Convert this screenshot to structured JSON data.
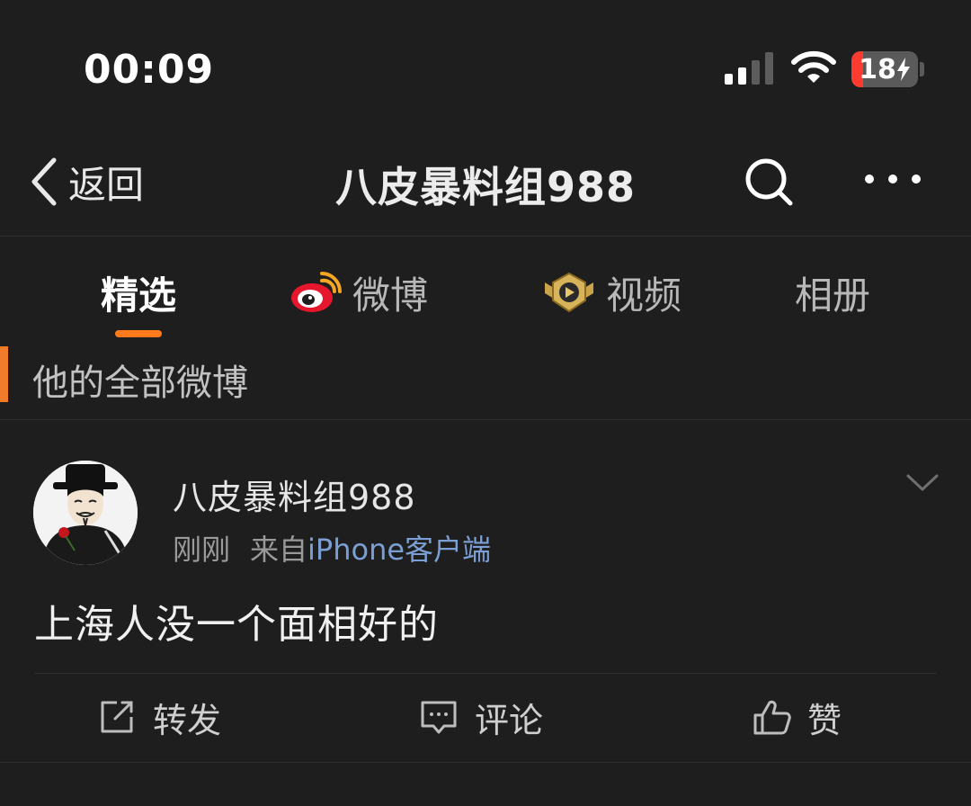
{
  "status_bar": {
    "time": "00:09",
    "battery_level": "18",
    "battery_fraction": 0.18,
    "charging": true
  },
  "navbar": {
    "back_label": "返回",
    "title": "八皮暴料组988"
  },
  "tabs": [
    {
      "label": "精选",
      "active": true
    },
    {
      "label": "微博",
      "icon": "weibo-logo-icon"
    },
    {
      "label": "视频",
      "icon": "video-badge-icon"
    },
    {
      "label": "相册"
    }
  ],
  "section": {
    "title": "他的全部微博"
  },
  "post": {
    "author": "八皮暴料组988",
    "time": "刚刚",
    "source_prefix": "来自",
    "source": "iPhone客户端",
    "content": "上海人没一个面相好的",
    "actions": {
      "repost": "转发",
      "comment": "评论",
      "like": "赞"
    }
  },
  "colors": {
    "background": "#1e1e1e",
    "accent": "#ff7a1a",
    "link": "#7b9ed4",
    "battery_low": "#ff3b30"
  }
}
